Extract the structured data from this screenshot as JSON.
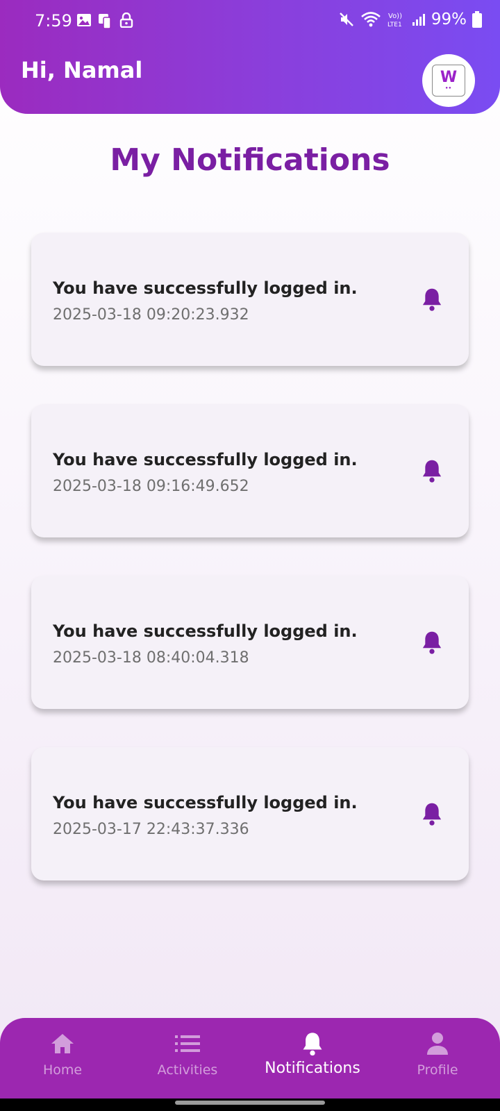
{
  "status_bar": {
    "time": "7:59",
    "battery": "99%"
  },
  "header": {
    "greeting": "Hi, Namal",
    "avatar_letter": "W"
  },
  "page": {
    "title": "My Notifications"
  },
  "notifications": [
    {
      "message": "You have successfully logged in.",
      "timestamp": "2025-03-18 09:20:23.932",
      "icon": "bell-icon"
    },
    {
      "message": "You have successfully logged in.",
      "timestamp": "2025-03-18 09:16:49.652",
      "icon": "bell-icon"
    },
    {
      "message": "You have successfully logged in.",
      "timestamp": "2025-03-18 08:40:04.318",
      "icon": "bell-icon"
    },
    {
      "message": "You have successfully logged in.",
      "timestamp": "2025-03-17 22:43:37.336",
      "icon": "bell-icon"
    }
  ],
  "bottom_nav": {
    "items": [
      {
        "label": "Home",
        "icon": "home-icon",
        "active": false
      },
      {
        "label": "Activities",
        "icon": "list-icon",
        "active": false
      },
      {
        "label": "Notifications",
        "icon": "bell-icon",
        "active": true
      },
      {
        "label": "Profile",
        "icon": "person-icon",
        "active": false
      }
    ]
  },
  "colors": {
    "accent": "#7a1fa3",
    "nav_bg": "#9c27b0",
    "header_start": "#9b2bbf",
    "header_end": "#7a4cf2"
  }
}
